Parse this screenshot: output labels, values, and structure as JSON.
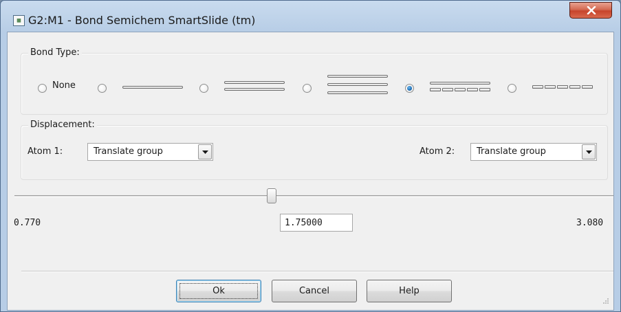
{
  "window": {
    "title": "G2:M1 - Bond Semichem SmartSlide (tm)",
    "app_icon": "document-grid-icon",
    "close_icon": "close-x-icon"
  },
  "bond_type": {
    "group_label": "Bond Type:",
    "options": [
      {
        "label": "None",
        "style": "none",
        "selected": false
      },
      {
        "label": "",
        "style": "single",
        "selected": false
      },
      {
        "label": "",
        "style": "double",
        "selected": false
      },
      {
        "label": "",
        "style": "triple",
        "selected": false
      },
      {
        "label": "",
        "style": "aromatic",
        "selected": true
      },
      {
        "label": "",
        "style": "partial",
        "selected": false
      }
    ]
  },
  "displacement": {
    "group_label": "Displacement:",
    "atom1_label": "Atom 1:",
    "atom1_value": "Translate group",
    "atom2_label": "Atom 2:",
    "atom2_value": "Translate group"
  },
  "slider": {
    "min_label": "0.770",
    "max_label": "3.080",
    "value": "1.75000",
    "min": 0.77,
    "max": 3.08,
    "current": 1.75
  },
  "buttons": {
    "ok": "Ok",
    "cancel": "Cancel",
    "help": "Help"
  },
  "colors": {
    "selected_radio": "#1e6fb6",
    "close_button": "#c7442b"
  }
}
